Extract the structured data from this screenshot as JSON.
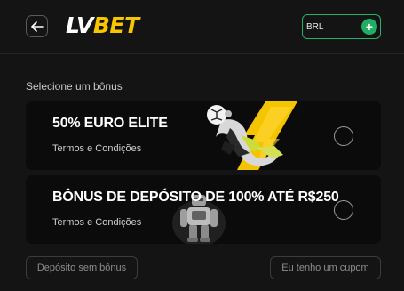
{
  "header": {
    "back_icon": "arrow-left-icon",
    "logo": {
      "lv": "LV",
      "bet": "BET"
    },
    "currency": {
      "code": "BRL",
      "add_icon": "plus-icon"
    }
  },
  "colors": {
    "background": "#141414",
    "card": "#0b0b0b",
    "brand_yellow": "#f7c600",
    "accent_green": "#1fae63"
  },
  "page": {
    "section_title": "Selecione um bônus"
  },
  "bonuses": [
    {
      "title": "50% EURO ELITE",
      "terms": "Termos e Condições",
      "selected": false,
      "image": "soccer-goalkeeper-lightning"
    },
    {
      "title": "BÔNUS DE DEPÓSITO DE 100% ATÉ R$250",
      "terms": "Termos e Condições",
      "selected": false,
      "image": "robot-figure"
    }
  ],
  "footer": {
    "no_bonus_label": "Depósito sem bônus",
    "coupon_label": "Eu tenho um cupom"
  }
}
